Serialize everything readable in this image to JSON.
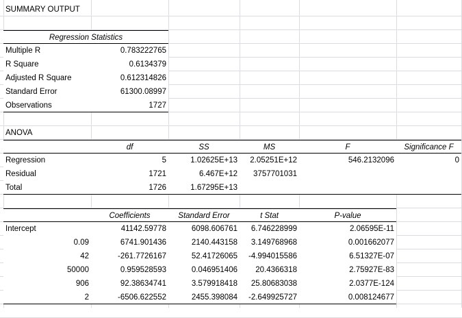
{
  "title": "SUMMARY OUTPUT",
  "regression_statistics": {
    "header": "Regression Statistics",
    "rows": [
      {
        "label": "Multiple R",
        "value": "0.783222765"
      },
      {
        "label": "R Square",
        "value": "0.6134379"
      },
      {
        "label": "Adjusted R Square",
        "value": "0.612314826"
      },
      {
        "label": "Standard Error",
        "value": "61300.08997"
      },
      {
        "label": "Observations",
        "value": "1727"
      }
    ]
  },
  "anova": {
    "title": "ANOVA",
    "headers": [
      "",
      "df",
      "SS",
      "MS",
      "F",
      "Significance F"
    ],
    "rows": [
      [
        "Regression",
        "5",
        "1.02625E+13",
        "2.05251E+12",
        "546.2132096",
        "0"
      ],
      [
        "Residual",
        "1721",
        "6.467E+12",
        "3757701031",
        "",
        ""
      ],
      [
        "Total",
        "1726",
        "1.67295E+13",
        "",
        "",
        ""
      ]
    ]
  },
  "coefficients": {
    "headers": [
      "",
      "Coefficients",
      "Standard Error",
      "t Stat",
      "P-value"
    ],
    "rows": [
      [
        "Intercept",
        "41142.59778",
        "6098.606761",
        "6.746228999",
        "2.06595E-11"
      ],
      [
        "0.09",
        "6741.901436",
        "2140.443158",
        "3.149768968",
        "0.001662077"
      ],
      [
        "42",
        "-261.7726167",
        "52.41726065",
        "-4.994015586",
        "6.51327E-07"
      ],
      [
        "50000",
        "0.959528593",
        "0.046951406",
        "20.4366318",
        "2.75927E-83"
      ],
      [
        "906",
        "92.38634741",
        "3.579918418",
        "25.80683038",
        "2.0377E-124"
      ],
      [
        "2",
        "-6506.622552",
        "2455.398084",
        "-2.649925727",
        "0.008124677"
      ]
    ]
  }
}
